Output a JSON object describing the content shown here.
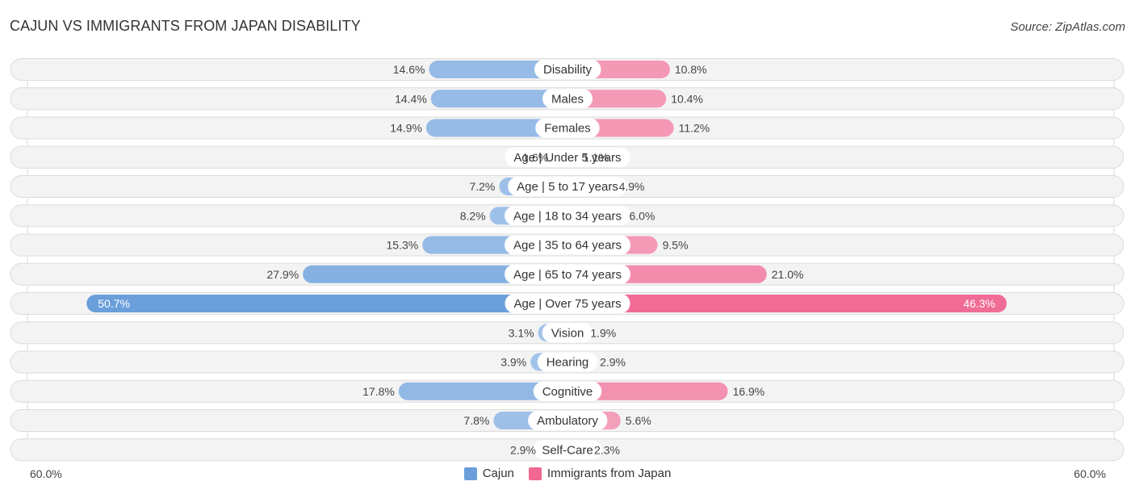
{
  "header": {
    "title": "CAJUN VS IMMIGRANTS FROM JAPAN DISABILITY",
    "source": "Source: ZipAtlas.com"
  },
  "colors": {
    "cajun": "#6a9fdb",
    "cajun_light": "#a7c6ea",
    "japan": "#f06792",
    "japan_light": "#f5a6bf",
    "row_bg": "#f3f3f3"
  },
  "legend": {
    "items": [
      {
        "label": "Cajun",
        "color": "#6a9fdb"
      },
      {
        "label": "Immigrants from Japan",
        "color": "#f06792"
      }
    ]
  },
  "axis": {
    "left_label": "60.0%",
    "right_label": "60.0%"
  },
  "chart_data": {
    "type": "bar",
    "orientation": "horizontal-diverging",
    "title": "CAJUN VS IMMIGRANTS FROM JAPAN DISABILITY",
    "xlim": [
      -60,
      60
    ],
    "x_tick_labels": [
      "60.0%",
      "60.0%"
    ],
    "legend_position": "bottom-center",
    "categories": [
      "Disability",
      "Males",
      "Females",
      "Age | Under 5 years",
      "Age | 5 to 17 years",
      "Age | 18 to 34 years",
      "Age | 35 to 64 years",
      "Age | 65 to 74 years",
      "Age | Over 75 years",
      "Vision",
      "Hearing",
      "Cognitive",
      "Ambulatory",
      "Self-Care"
    ],
    "series": [
      {
        "name": "Cajun",
        "side": "left",
        "values": [
          14.6,
          14.4,
          14.9,
          1.6,
          7.2,
          8.2,
          15.3,
          27.9,
          50.7,
          3.1,
          3.9,
          17.8,
          7.8,
          2.9
        ],
        "labels": [
          "14.6%",
          "14.4%",
          "14.9%",
          "1.6%",
          "7.2%",
          "8.2%",
          "15.3%",
          "27.9%",
          "50.7%",
          "3.1%",
          "3.9%",
          "17.8%",
          "7.8%",
          "2.9%"
        ]
      },
      {
        "name": "Immigrants from Japan",
        "side": "right",
        "values": [
          10.8,
          10.4,
          11.2,
          1.1,
          4.9,
          6.0,
          9.5,
          21.0,
          46.3,
          1.9,
          2.9,
          16.9,
          5.6,
          2.3
        ],
        "labels": [
          "10.8%",
          "10.4%",
          "11.2%",
          "1.1%",
          "4.9%",
          "6.0%",
          "9.5%",
          "21.0%",
          "46.3%",
          "1.9%",
          "2.9%",
          "16.9%",
          "5.6%",
          "2.3%"
        ]
      }
    ]
  }
}
